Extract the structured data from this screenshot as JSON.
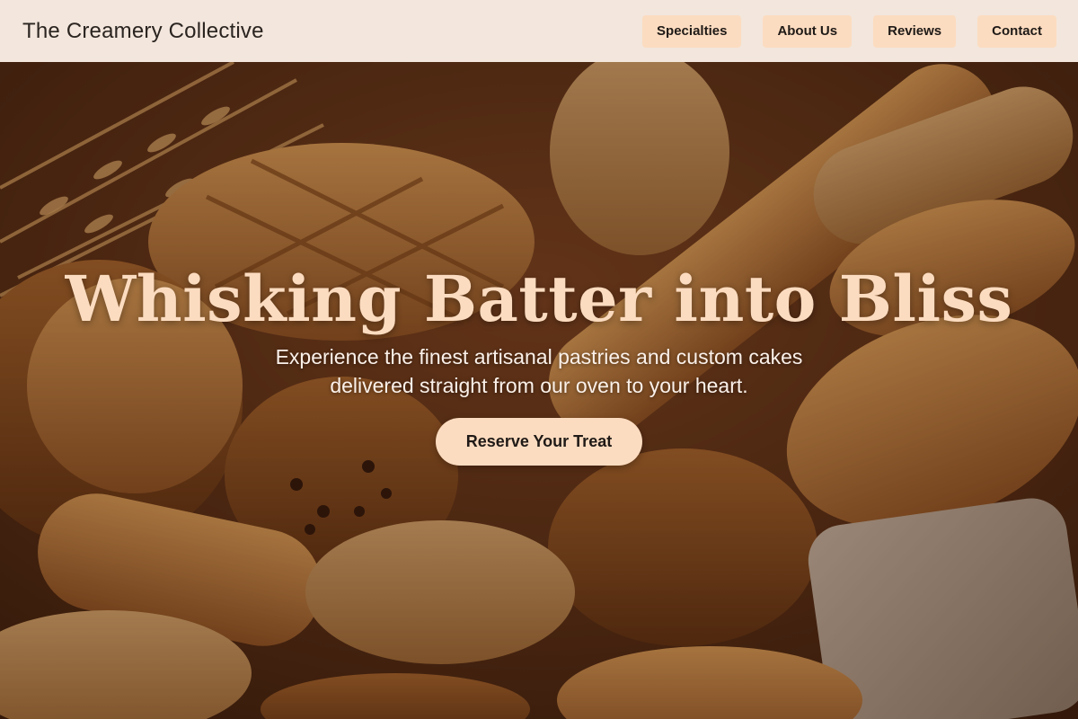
{
  "header": {
    "brand": "The Creamery Collective",
    "nav": [
      "Specialties",
      "About Us",
      "Reviews",
      "Contact"
    ]
  },
  "hero": {
    "headline": "Whisking Batter into Bliss",
    "subtext": "Experience the finest artisanal pastries and custom cakes delivered straight from our oven to your heart.",
    "cta_label": "Reserve Your Treat",
    "background": "bread-basket-photo"
  },
  "colors": {
    "header_bg": "#f3e6dc",
    "accent": "#fcdcc0",
    "text_dark": "#1f1a17",
    "headline": "#fcdcc0"
  }
}
